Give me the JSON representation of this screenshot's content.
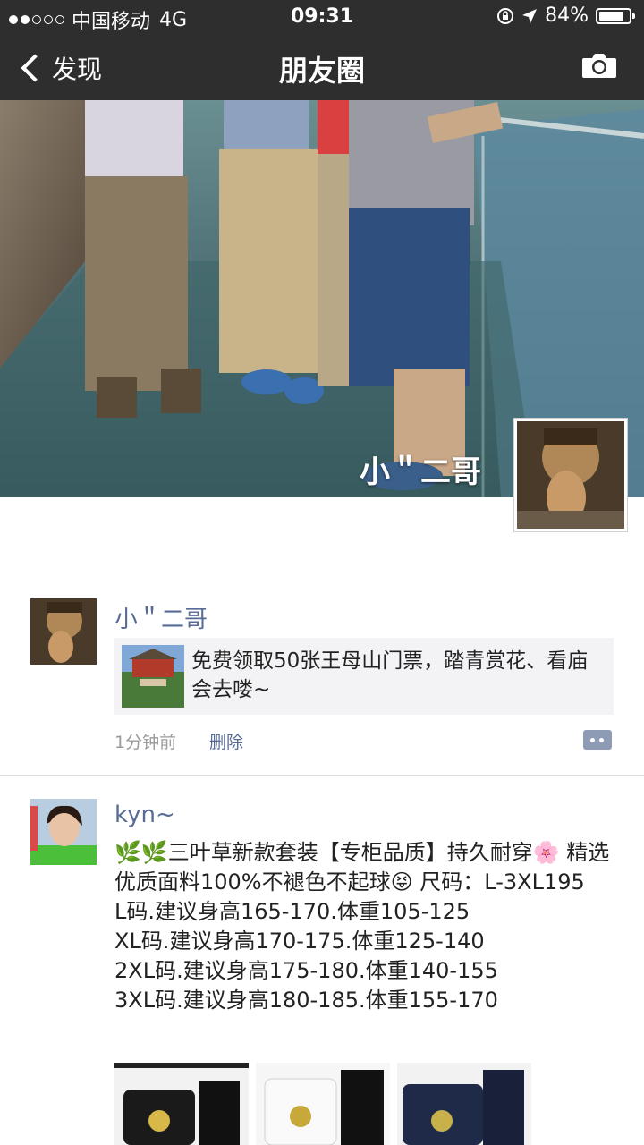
{
  "status_bar": {
    "carrier": "中国移动",
    "network": "4G",
    "time": "09:31",
    "battery": "84%",
    "battery_level": 0.84
  },
  "nav": {
    "back_label": "发现",
    "title": "朋友圈"
  },
  "profile": {
    "name": "小＂二哥"
  },
  "posts": [
    {
      "username": "小＂二哥",
      "link_text": "免费领取50张王母山门票，踏青赏花、看庙会去喽~",
      "time": "1分钟前",
      "delete_label": "删除"
    },
    {
      "username": "kyn~",
      "text": "🌿🌿三叶草新款套装【专柜品质】持久耐穿🌸 精选优质面料100%不褪色不起球😝 尺码：L-3XL195\nL码.建议身高165-170.体重105-125\nXL码.建议身高170-175.体重125-140\n2XL码.建议身高175-180.体重140-155\n3XL码.建议身高180-185.体重155-170"
    }
  ],
  "colors": {
    "bar_bg": "#2e2e2e",
    "link_blue": "#576b95",
    "meta_gray": "#9a9a9a"
  }
}
